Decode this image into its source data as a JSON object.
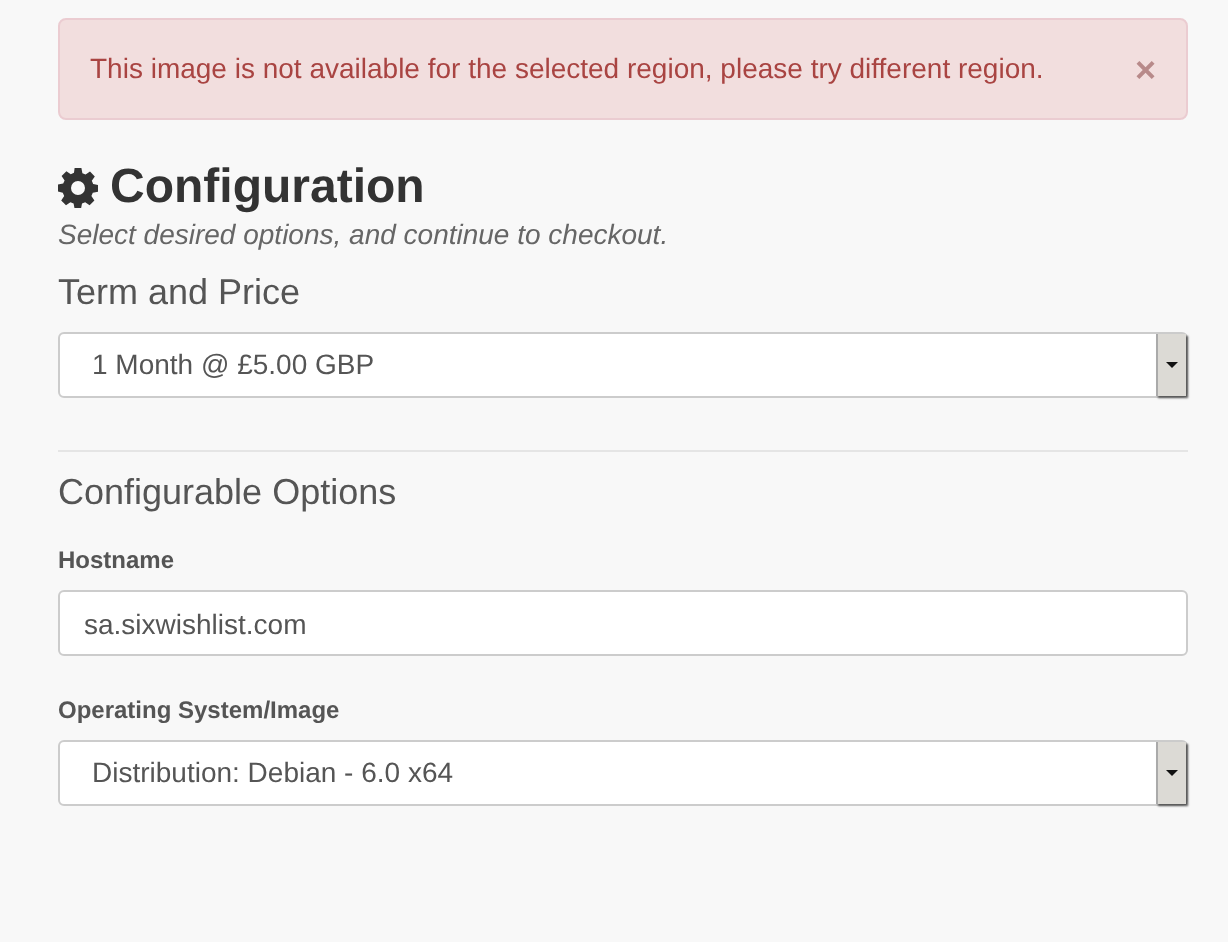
{
  "alert": {
    "message": "This image is not available for the selected region, please try different region.",
    "close": "×"
  },
  "heading": {
    "title": "Configuration",
    "subtitle": "Select desired options, and continue to checkout."
  },
  "term": {
    "label": "Term and Price",
    "value": "1 Month @ £5.00 GBP"
  },
  "options": {
    "title": "Configurable Options",
    "fields": [
      {
        "kind": "text",
        "label": "Hostname",
        "value": "sa.sixwishlist.com"
      },
      {
        "kind": "select",
        "label": "Operating System/Image",
        "value": "Distribution: Debian - 6.0 x64"
      }
    ]
  }
}
